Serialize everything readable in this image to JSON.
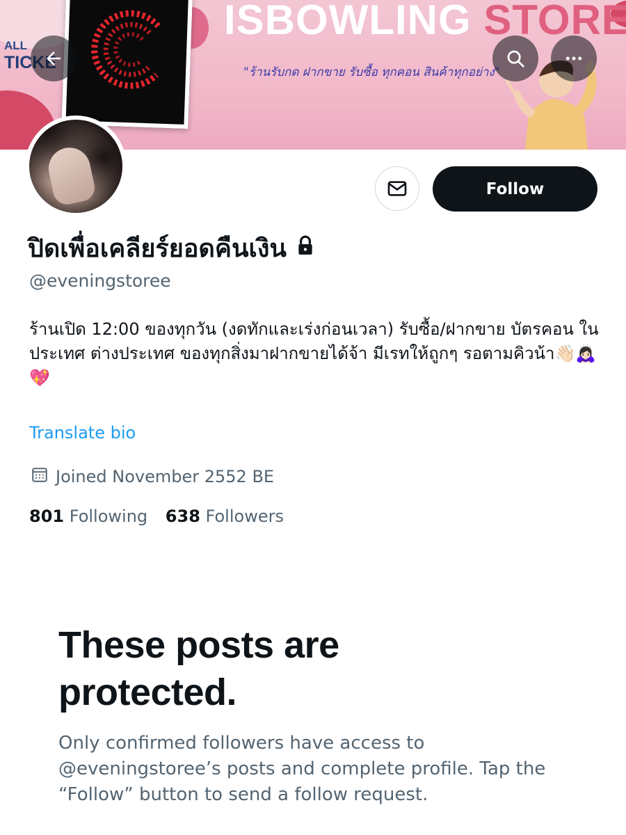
{
  "banner": {
    "badge_line1": "ALL",
    "badge_line2": "TICKE",
    "store_title_part1": "ISBOWLING",
    "store_title_part2": "STORE",
    "tagline": "\"ร้านรับกด ฝากขาย รับซื้อ ทุกคอน สินค้าทุกอย่าง\""
  },
  "nav": {
    "back_icon": "arrow-left-icon",
    "search_icon": "search-icon",
    "more_icon": "more-horizontal-icon"
  },
  "profile": {
    "display_name": "ปิดเพื่อเคลียร์ยอดคืนเงิน",
    "handle": "@eveningstoree",
    "bio": "ร้านเปิด 12:00 ของทุกวัน (งดทักและเร่งก่อนเวลา) รับซื้อ/ฝากขาย บัตรคอน ในประเทศ ต่างประเทศ ของทุกสิ่งมาฝากขายได้จ้า มีเรทให้ถูกๆ รอตามคิวน้า👋🏻🙇🏻‍♀️💖",
    "translate_label": "Translate bio",
    "joined": "Joined November 2552 BE",
    "following_count": "801",
    "following_label": "Following",
    "followers_count": "638",
    "followers_label": "Followers"
  },
  "actions": {
    "follow_label": "Follow",
    "message_icon": "mail-icon"
  },
  "protected": {
    "title": "These posts are protected.",
    "description": "Only confirmed followers have access to @eveningstoree’s posts and complete profile. Tap the “Follow” button to send a follow request."
  },
  "colors": {
    "accent_link": "#1d9bf0",
    "text_primary": "#0f1419",
    "text_secondary": "#536471",
    "follow_bg": "#0f1419"
  }
}
